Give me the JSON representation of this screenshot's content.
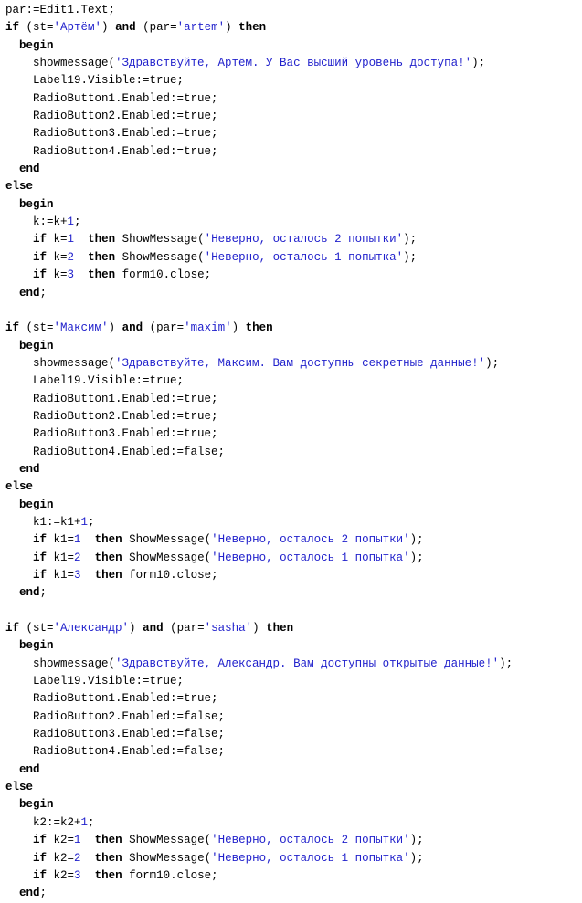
{
  "document": {
    "kind": "source-code-listing",
    "language": "Delphi / Object Pascal",
    "background_color": "#ffffff",
    "text_color": "#000000",
    "literal_color": "#2222cc",
    "keyword_style": "bold"
  },
  "code": {
    "lines": [
      [
        {
          "t": "plain",
          "s": "par:=Edit1.Text;"
        }
      ],
      [
        {
          "t": "kw",
          "s": "if"
        },
        {
          "t": "plain",
          "s": " (st="
        },
        {
          "t": "str",
          "s": "'Артём'"
        },
        {
          "t": "plain",
          "s": ") "
        },
        {
          "t": "kw",
          "s": "and"
        },
        {
          "t": "plain",
          "s": " (par="
        },
        {
          "t": "str",
          "s": "'artem'"
        },
        {
          "t": "plain",
          "s": ") "
        },
        {
          "t": "kw",
          "s": "then"
        }
      ],
      [
        {
          "t": "plain",
          "s": "  "
        },
        {
          "t": "kw",
          "s": "begin"
        }
      ],
      [
        {
          "t": "plain",
          "s": "    showmessage("
        },
        {
          "t": "str",
          "s": "'Здравствуйте, Артём. У Вас высший уровень доступа!'"
        },
        {
          "t": "plain",
          "s": ");"
        }
      ],
      [
        {
          "t": "plain",
          "s": "    Label19.Visible:=true;"
        }
      ],
      [
        {
          "t": "plain",
          "s": "    RadioButton1.Enabled:=true;"
        }
      ],
      [
        {
          "t": "plain",
          "s": "    RadioButton2.Enabled:=true;"
        }
      ],
      [
        {
          "t": "plain",
          "s": "    RadioButton3.Enabled:=true;"
        }
      ],
      [
        {
          "t": "plain",
          "s": "    RadioButton4.Enabled:=true;"
        }
      ],
      [
        {
          "t": "plain",
          "s": "  "
        },
        {
          "t": "kw",
          "s": "end"
        }
      ],
      [
        {
          "t": "kw",
          "s": "else"
        }
      ],
      [
        {
          "t": "plain",
          "s": "  "
        },
        {
          "t": "kw",
          "s": "begin"
        }
      ],
      [
        {
          "t": "plain",
          "s": "    k:=k+"
        },
        {
          "t": "num",
          "s": "1"
        },
        {
          "t": "plain",
          "s": ";"
        }
      ],
      [
        {
          "t": "plain",
          "s": "    "
        },
        {
          "t": "kw",
          "s": "if"
        },
        {
          "t": "plain",
          "s": " k="
        },
        {
          "t": "num",
          "s": "1"
        },
        {
          "t": "plain",
          "s": "  "
        },
        {
          "t": "kw",
          "s": "then"
        },
        {
          "t": "plain",
          "s": " ShowMessage("
        },
        {
          "t": "str",
          "s": "'Неверно, осталось 2 попытки'"
        },
        {
          "t": "plain",
          "s": ");"
        }
      ],
      [
        {
          "t": "plain",
          "s": "    "
        },
        {
          "t": "kw",
          "s": "if"
        },
        {
          "t": "plain",
          "s": " k="
        },
        {
          "t": "num",
          "s": "2"
        },
        {
          "t": "plain",
          "s": "  "
        },
        {
          "t": "kw",
          "s": "then"
        },
        {
          "t": "plain",
          "s": " ShowMessage("
        },
        {
          "t": "str",
          "s": "'Неверно, осталось 1 попытка'"
        },
        {
          "t": "plain",
          "s": ");"
        }
      ],
      [
        {
          "t": "plain",
          "s": "    "
        },
        {
          "t": "kw",
          "s": "if"
        },
        {
          "t": "plain",
          "s": " k="
        },
        {
          "t": "num",
          "s": "3"
        },
        {
          "t": "plain",
          "s": "  "
        },
        {
          "t": "kw",
          "s": "then"
        },
        {
          "t": "plain",
          "s": " form10.close;"
        }
      ],
      [
        {
          "t": "plain",
          "s": "  "
        },
        {
          "t": "kw",
          "s": "end"
        },
        {
          "t": "plain",
          "s": ";"
        }
      ],
      [],
      [
        {
          "t": "kw",
          "s": "if"
        },
        {
          "t": "plain",
          "s": " (st="
        },
        {
          "t": "str",
          "s": "'Максим'"
        },
        {
          "t": "plain",
          "s": ") "
        },
        {
          "t": "kw",
          "s": "and"
        },
        {
          "t": "plain",
          "s": " (par="
        },
        {
          "t": "str",
          "s": "'maxim'"
        },
        {
          "t": "plain",
          "s": ") "
        },
        {
          "t": "kw",
          "s": "then"
        }
      ],
      [
        {
          "t": "plain",
          "s": "  "
        },
        {
          "t": "kw",
          "s": "begin"
        }
      ],
      [
        {
          "t": "plain",
          "s": "    showmessage("
        },
        {
          "t": "str",
          "s": "'Здравствуйте, Максим. Вам доступны секретные данные!'"
        },
        {
          "t": "plain",
          "s": ");"
        }
      ],
      [
        {
          "t": "plain",
          "s": "    Label19.Visible:=true;"
        }
      ],
      [
        {
          "t": "plain",
          "s": "    RadioButton1.Enabled:=true;"
        }
      ],
      [
        {
          "t": "plain",
          "s": "    RadioButton2.Enabled:=true;"
        }
      ],
      [
        {
          "t": "plain",
          "s": "    RadioButton3.Enabled:=true;"
        }
      ],
      [
        {
          "t": "plain",
          "s": "    RadioButton4.Enabled:=false;"
        }
      ],
      [
        {
          "t": "plain",
          "s": "  "
        },
        {
          "t": "kw",
          "s": "end"
        }
      ],
      [
        {
          "t": "kw",
          "s": "else"
        }
      ],
      [
        {
          "t": "plain",
          "s": "  "
        },
        {
          "t": "kw",
          "s": "begin"
        }
      ],
      [
        {
          "t": "plain",
          "s": "    k1:=k1+"
        },
        {
          "t": "num",
          "s": "1"
        },
        {
          "t": "plain",
          "s": ";"
        }
      ],
      [
        {
          "t": "plain",
          "s": "    "
        },
        {
          "t": "kw",
          "s": "if"
        },
        {
          "t": "plain",
          "s": " k1="
        },
        {
          "t": "num",
          "s": "1"
        },
        {
          "t": "plain",
          "s": "  "
        },
        {
          "t": "kw",
          "s": "then"
        },
        {
          "t": "plain",
          "s": " ShowMessage("
        },
        {
          "t": "str",
          "s": "'Неверно, осталось 2 попытки'"
        },
        {
          "t": "plain",
          "s": ");"
        }
      ],
      [
        {
          "t": "plain",
          "s": "    "
        },
        {
          "t": "kw",
          "s": "if"
        },
        {
          "t": "plain",
          "s": " k1="
        },
        {
          "t": "num",
          "s": "2"
        },
        {
          "t": "plain",
          "s": "  "
        },
        {
          "t": "kw",
          "s": "then"
        },
        {
          "t": "plain",
          "s": " ShowMessage("
        },
        {
          "t": "str",
          "s": "'Неверно, осталось 1 попытка'"
        },
        {
          "t": "plain",
          "s": ");"
        }
      ],
      [
        {
          "t": "plain",
          "s": "    "
        },
        {
          "t": "kw",
          "s": "if"
        },
        {
          "t": "plain",
          "s": " k1="
        },
        {
          "t": "num",
          "s": "3"
        },
        {
          "t": "plain",
          "s": "  "
        },
        {
          "t": "kw",
          "s": "then"
        },
        {
          "t": "plain",
          "s": " form10.close;"
        }
      ],
      [
        {
          "t": "plain",
          "s": "  "
        },
        {
          "t": "kw",
          "s": "end"
        },
        {
          "t": "plain",
          "s": ";"
        }
      ],
      [],
      [
        {
          "t": "kw",
          "s": "if"
        },
        {
          "t": "plain",
          "s": " (st="
        },
        {
          "t": "str",
          "s": "'Александр'"
        },
        {
          "t": "plain",
          "s": ") "
        },
        {
          "t": "kw",
          "s": "and"
        },
        {
          "t": "plain",
          "s": " (par="
        },
        {
          "t": "str",
          "s": "'sasha'"
        },
        {
          "t": "plain",
          "s": ") "
        },
        {
          "t": "kw",
          "s": "then"
        }
      ],
      [
        {
          "t": "plain",
          "s": "  "
        },
        {
          "t": "kw",
          "s": "begin"
        }
      ],
      [
        {
          "t": "plain",
          "s": "    showmessage("
        },
        {
          "t": "str",
          "s": "'Здравствуйте, Александр. Вам доступны открытые данные!'"
        },
        {
          "t": "plain",
          "s": ");"
        }
      ],
      [
        {
          "t": "plain",
          "s": "    Label19.Visible:=true;"
        }
      ],
      [
        {
          "t": "plain",
          "s": "    RadioButton1.Enabled:=true;"
        }
      ],
      [
        {
          "t": "plain",
          "s": "    RadioButton2.Enabled:=false;"
        }
      ],
      [
        {
          "t": "plain",
          "s": "    RadioButton3.Enabled:=false;"
        }
      ],
      [
        {
          "t": "plain",
          "s": "    RadioButton4.Enabled:=false;"
        }
      ],
      [
        {
          "t": "plain",
          "s": "  "
        },
        {
          "t": "kw",
          "s": "end"
        }
      ],
      [
        {
          "t": "kw",
          "s": "else"
        }
      ],
      [
        {
          "t": "plain",
          "s": "  "
        },
        {
          "t": "kw",
          "s": "begin"
        }
      ],
      [
        {
          "t": "plain",
          "s": "    k2:=k2+"
        },
        {
          "t": "num",
          "s": "1"
        },
        {
          "t": "plain",
          "s": ";"
        }
      ],
      [
        {
          "t": "plain",
          "s": "    "
        },
        {
          "t": "kw",
          "s": "if"
        },
        {
          "t": "plain",
          "s": " k2="
        },
        {
          "t": "num",
          "s": "1"
        },
        {
          "t": "plain",
          "s": "  "
        },
        {
          "t": "kw",
          "s": "then"
        },
        {
          "t": "plain",
          "s": " ShowMessage("
        },
        {
          "t": "str",
          "s": "'Неверно, осталось 2 попытки'"
        },
        {
          "t": "plain",
          "s": ");"
        }
      ],
      [
        {
          "t": "plain",
          "s": "    "
        },
        {
          "t": "kw",
          "s": "if"
        },
        {
          "t": "plain",
          "s": " k2="
        },
        {
          "t": "num",
          "s": "2"
        },
        {
          "t": "plain",
          "s": "  "
        },
        {
          "t": "kw",
          "s": "then"
        },
        {
          "t": "plain",
          "s": " ShowMessage("
        },
        {
          "t": "str",
          "s": "'Неверно, осталось 1 попытка'"
        },
        {
          "t": "plain",
          "s": ");"
        }
      ],
      [
        {
          "t": "plain",
          "s": "    "
        },
        {
          "t": "kw",
          "s": "if"
        },
        {
          "t": "plain",
          "s": " k2="
        },
        {
          "t": "num",
          "s": "3"
        },
        {
          "t": "plain",
          "s": "  "
        },
        {
          "t": "kw",
          "s": "then"
        },
        {
          "t": "plain",
          "s": " form10.close;"
        }
      ],
      [
        {
          "t": "plain",
          "s": "  "
        },
        {
          "t": "kw",
          "s": "end"
        },
        {
          "t": "plain",
          "s": ";"
        }
      ]
    ]
  }
}
